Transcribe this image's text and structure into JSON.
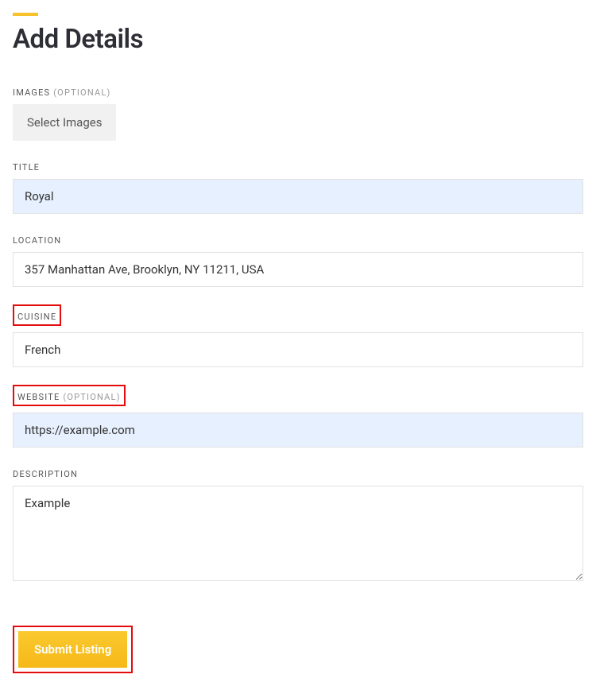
{
  "header": {
    "title": "Add Details"
  },
  "images": {
    "label": "IMAGES ",
    "optional": "(OPTIONAL)",
    "button": "Select Images"
  },
  "title": {
    "label": "TITLE",
    "value": "Royal"
  },
  "location": {
    "label": "LOCATION",
    "value": "357 Manhattan Ave, Brooklyn, NY 11211, USA"
  },
  "cuisine": {
    "label": "CUISINE",
    "value": "French"
  },
  "website": {
    "label": "WEBSITE ",
    "optional": "(OPTIONAL)",
    "value": "https://example.com"
  },
  "description": {
    "label": "DESCRIPTION",
    "value": "Example"
  },
  "submit": {
    "label": "Submit Listing"
  }
}
